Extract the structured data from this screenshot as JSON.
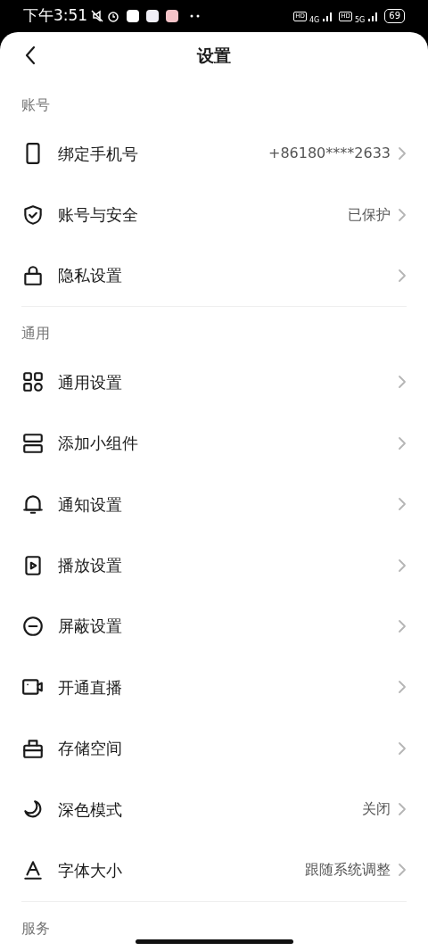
{
  "status_bar": {
    "time": "下午3:51",
    "sim1_badge": "HD",
    "sim1_network": "4G",
    "sim2_badge": "HD",
    "sim2_network": "5G",
    "battery": "69"
  },
  "header": {
    "title": "设置"
  },
  "sections": [
    {
      "title": "账号",
      "items": [
        {
          "label": "绑定手机号",
          "value": "+86180****2633"
        },
        {
          "label": "账号与安全",
          "value": "已保护"
        },
        {
          "label": "隐私设置"
        }
      ]
    },
    {
      "title": "通用",
      "items": [
        {
          "label": "通用设置"
        },
        {
          "label": "添加小组件"
        },
        {
          "label": "通知设置"
        },
        {
          "label": "播放设置"
        },
        {
          "label": "屏蔽设置"
        },
        {
          "label": "开通直播"
        },
        {
          "label": "存储空间"
        },
        {
          "label": "深色模式",
          "value": "关闭"
        },
        {
          "label": "字体大小",
          "value": "跟随系统调整"
        }
      ]
    },
    {
      "title": "服务"
    }
  ]
}
